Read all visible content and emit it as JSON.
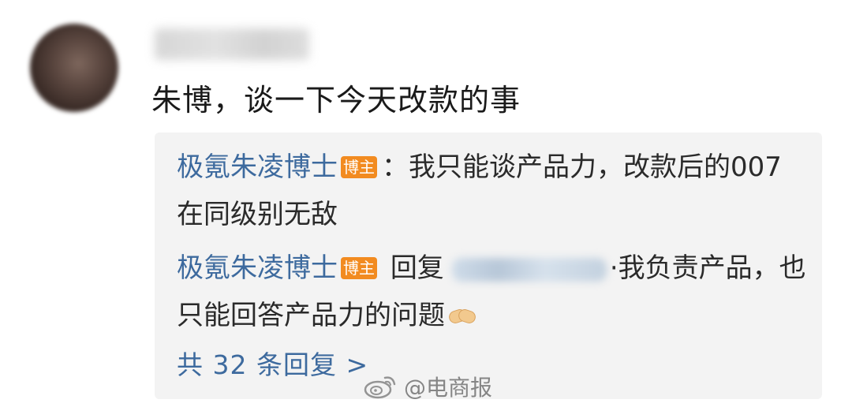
{
  "comment": {
    "text": "朱博，谈一下今天改款的事"
  },
  "replies": [
    {
      "author": "极氪朱凌博士",
      "badge": "博主",
      "separator": "：",
      "text": "我只能谈产品力，改款后的007在同级别无敌"
    },
    {
      "author": "极氪朱凌博士",
      "badge": "博主",
      "prefix": "回复",
      "separator": "·",
      "text": "我负责产品，也只能回答产品力的问题"
    }
  ],
  "more_replies": "共 32 条回复 >",
  "watermark": "@电商报",
  "colors": {
    "author": "#3d6a9e",
    "badge": "#f28b20",
    "reply_bg": "#f3f3f3"
  },
  "icons": [
    "avatar",
    "handshake-emoji-icon",
    "weibo-logo-icon"
  ]
}
